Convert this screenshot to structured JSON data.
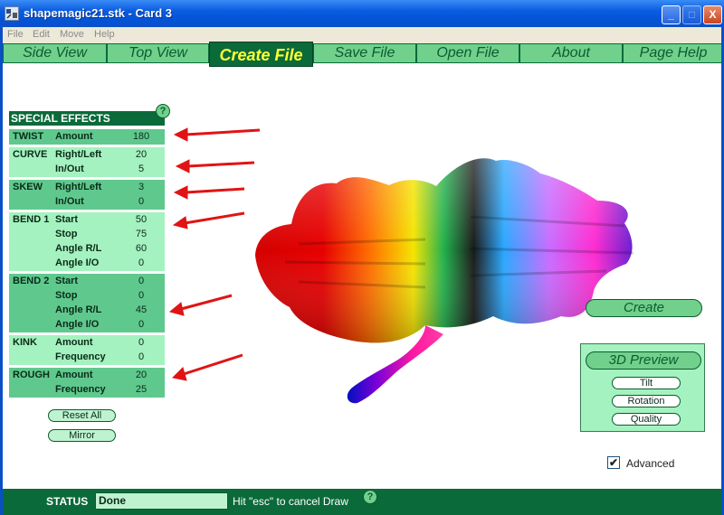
{
  "window": {
    "title": "shapemagic21.stk - Card 3",
    "min_glyph": "_",
    "max_glyph": "□",
    "close_glyph": "X"
  },
  "menu": [
    "File",
    "Edit",
    "Move",
    "Help"
  ],
  "nav": [
    "Side View",
    "Top View",
    "Create File",
    "Save File",
    "Open File",
    "About",
    "Page Help"
  ],
  "nav_active_index": 2,
  "special_effects": {
    "header": "SPECIAL EFFECTS",
    "help": "?",
    "groups": [
      {
        "name": "TWIST",
        "rows": [
          {
            "label": "Amount",
            "value": "180"
          }
        ]
      },
      {
        "name": "CURVE",
        "rows": [
          {
            "label": "Right/Left",
            "value": "20"
          },
          {
            "label": "In/Out",
            "value": "5"
          }
        ]
      },
      {
        "name": "SKEW",
        "rows": [
          {
            "label": "Right/Left",
            "value": "3"
          },
          {
            "label": "In/Out",
            "value": "0"
          }
        ]
      },
      {
        "name": "BEND 1",
        "rows": [
          {
            "label": "Start",
            "value": "50"
          },
          {
            "label": "Stop",
            "value": "75"
          },
          {
            "label": "Angle R/L",
            "value": "60"
          },
          {
            "label": "Angle I/O",
            "value": "0"
          }
        ]
      },
      {
        "name": "BEND 2",
        "rows": [
          {
            "label": "Start",
            "value": "0"
          },
          {
            "label": "Stop",
            "value": "0"
          },
          {
            "label": "Angle R/L",
            "value": "45"
          },
          {
            "label": "Angle I/O",
            "value": "0"
          }
        ]
      },
      {
        "name": "KINK",
        "rows": [
          {
            "label": "Amount",
            "value": "0"
          },
          {
            "label": "Frequency",
            "value": "0"
          }
        ]
      },
      {
        "name": "ROUGH",
        "rows": [
          {
            "label": "Amount",
            "value": "20"
          },
          {
            "label": "Frequency",
            "value": "25"
          }
        ]
      }
    ],
    "reset_label": "Reset All",
    "mirror_label": "Mirror"
  },
  "create_label": "Create",
  "preview": {
    "title": "3D Preview",
    "tilt": "Tilt",
    "rotation": "Rotation",
    "quality": "Quality"
  },
  "advanced": {
    "label": "Advanced",
    "checked": true,
    "check_glyph": "✔"
  },
  "status": {
    "label": "STATUS",
    "value": "Done",
    "hint": "Hit \"esc\" to cancel Draw",
    "help": "?"
  },
  "colors": {
    "nav_bg": "#71d08c",
    "dark_green": "#0b6a3a",
    "panel_dark": "#5fc98d",
    "panel_light": "#a4f2bf",
    "arrow_red": "#e01414",
    "active_text": "#ffff33"
  }
}
